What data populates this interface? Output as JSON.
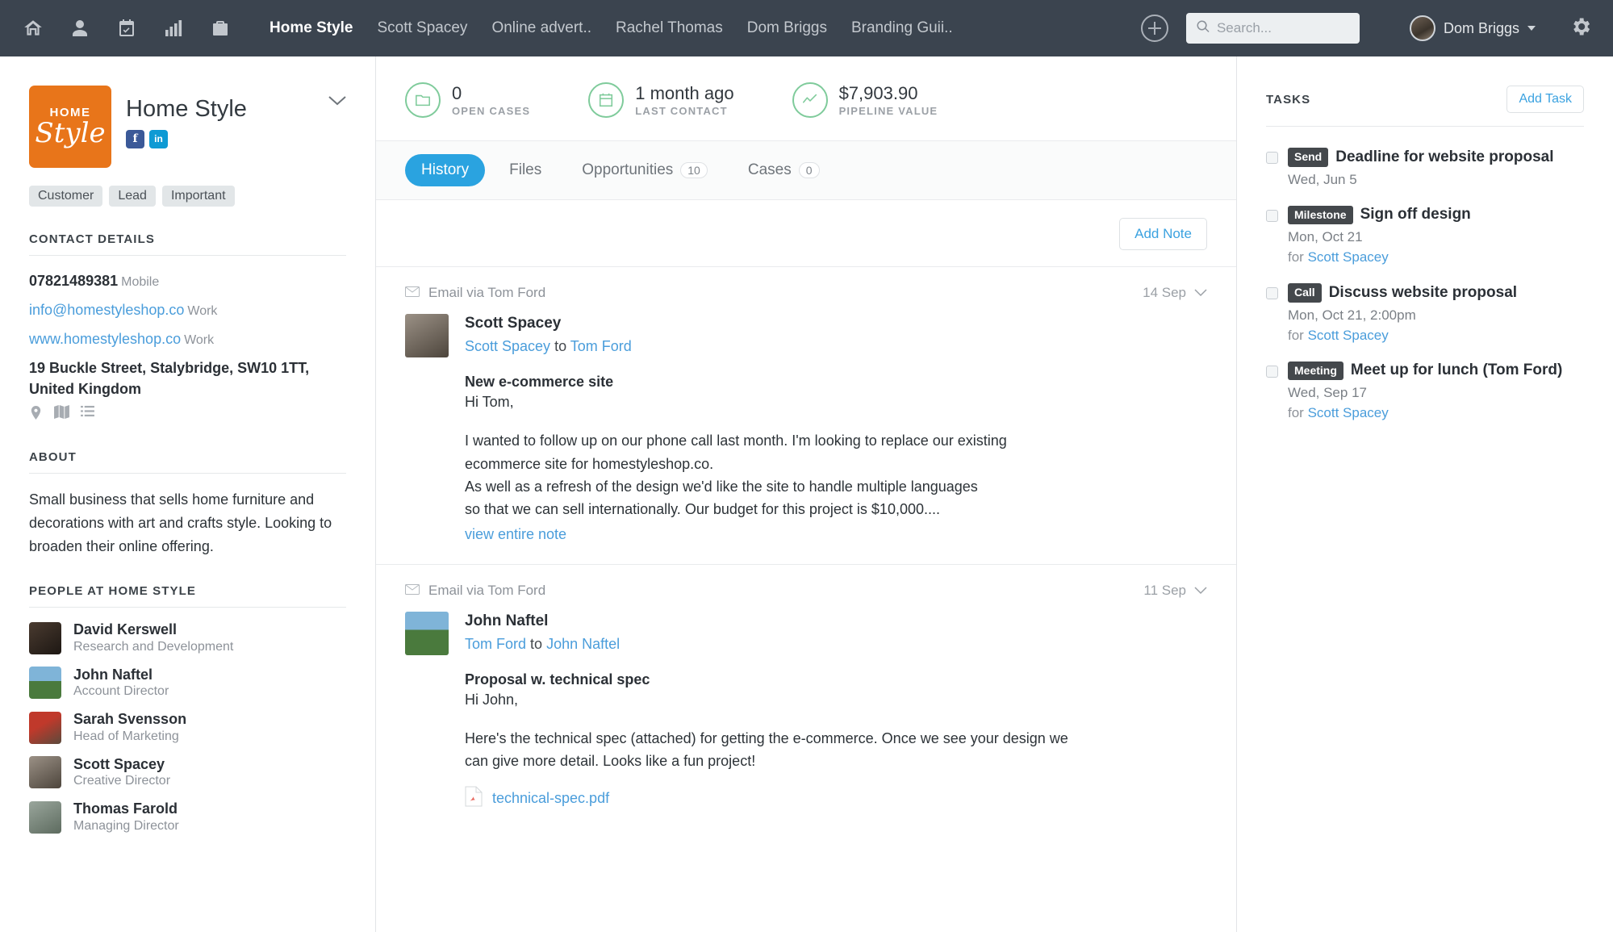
{
  "topnav": {
    "icons": [
      "home-icon",
      "person-icon",
      "calendar-icon",
      "chart-icon",
      "briefcase-icon"
    ],
    "tabs": [
      {
        "label": "Home Style",
        "active": true
      },
      {
        "label": "Scott Spacey",
        "active": false
      },
      {
        "label": "Online advert..",
        "active": false
      },
      {
        "label": "Rachel Thomas",
        "active": false
      },
      {
        "label": "Dom Briggs",
        "active": false
      },
      {
        "label": "Branding Guii..",
        "active": false
      }
    ],
    "search_placeholder": "Search...",
    "user_name": "Dom Briggs"
  },
  "company": {
    "logo_top": "HOME",
    "logo_bottom": "Style",
    "name": "Home Style",
    "socials": [
      {
        "name": "facebook-icon",
        "glyph": "f"
      },
      {
        "name": "linkedin-icon",
        "glyph": "in"
      }
    ],
    "tags": [
      "Customer",
      "Lead",
      "Important"
    ],
    "contact_details_heading": "CONTACT DETAILS",
    "contacts": [
      {
        "value": "07821489381",
        "label": "Mobile",
        "is_link": false
      },
      {
        "value": "info@homestyleshop.co",
        "label": "Work",
        "is_link": true
      },
      {
        "value": "www.homestyleshop.co",
        "label": "Work",
        "is_link": true
      }
    ],
    "address": "19 Buckle Street, Stalybridge, SW10 1TT, United Kingdom",
    "about_heading": "ABOUT",
    "about_text": "Small business that sells home furniture and decorations with art and crafts style. Looking to broaden their online offering.",
    "people_heading": "PEOPLE AT HOME STYLE",
    "people": [
      {
        "name": "David Kerswell",
        "role": "Research and Development",
        "color1": "#4a3b30",
        "color2": "#1d1713"
      },
      {
        "name": "John Naftel",
        "role": "Account Director",
        "color1": "#7fb4d8",
        "color2": "#4a7a3d"
      },
      {
        "name": "Sarah Svensson",
        "role": "Head of Marketing",
        "color1": "#c0392b",
        "color2": "#5b4a3c"
      },
      {
        "name": "Scott Spacey",
        "role": "Creative Director",
        "color1": "#9b9186",
        "color2": "#4d453c"
      },
      {
        "name": "Thomas Farold",
        "role": "Managing Director",
        "color1": "#9aa69c",
        "color2": "#5d6b5f"
      }
    ]
  },
  "stats": [
    {
      "value": "0",
      "label": "OPEN CASES",
      "icon": "folder-icon"
    },
    {
      "value": "1 month ago",
      "label": "LAST CONTACT",
      "icon": "calendar-icon"
    },
    {
      "value": "$7,903.90",
      "label": "PIPELINE VALUE",
      "icon": "trend-icon"
    }
  ],
  "tabs": [
    {
      "label": "History",
      "count": null,
      "active": true
    },
    {
      "label": "Files",
      "count": null,
      "active": false
    },
    {
      "label": "Opportunities",
      "count": "10",
      "active": false
    },
    {
      "label": "Cases",
      "count": "0",
      "active": false
    }
  ],
  "add_note_label": "Add Note",
  "feed": [
    {
      "source": "Email via Tom Ford",
      "date": "14 Sep",
      "sender": "Scott Spacey",
      "route_from": "Scott Spacey",
      "route_joiner": "to",
      "route_to": "Tom Ford",
      "subject": "New e-commerce site",
      "greeting": "Hi Tom,",
      "lines": [
        "I wanted to follow up on our phone call last month. I'm looking to replace our existing",
        "ecommerce site for homestyleshop.co.",
        "As well as a refresh of the design we'd like the site to handle multiple languages",
        "so that we can sell internationally. Our budget for this project is $10,000...."
      ],
      "view_more": "view entire note",
      "attachment": null,
      "avatar_c1": "#9b9186",
      "avatar_c2": "#4d453c"
    },
    {
      "source": "Email via Tom Ford",
      "date": "11 Sep",
      "sender": "John Naftel",
      "route_from": "Tom Ford",
      "route_joiner": "to",
      "route_to": "John Naftel",
      "subject": "Proposal w. technical spec",
      "greeting": "Hi John,",
      "lines": [
        "Here's the technical spec (attached) for getting the e-commerce. Once we see your design we",
        "can give more detail. Looks like a fun project!"
      ],
      "view_more": null,
      "attachment": "technical-spec.pdf",
      "avatar_c1": "#7fb4d8",
      "avatar_c2": "#4a7a3d"
    }
  ],
  "tasks_panel": {
    "title": "TASKS",
    "add_label": "Add Task",
    "tasks": [
      {
        "badge": "Send",
        "title": "Deadline for website proposal",
        "date": "Wed, Jun 5",
        "for_label": null,
        "for_person": null
      },
      {
        "badge": "Milestone",
        "title": "Sign off design",
        "date": "Mon, Oct 21",
        "for_label": "for",
        "for_person": "Scott Spacey"
      },
      {
        "badge": "Call",
        "title": "Discuss website proposal",
        "date": "Mon, Oct 21, 2:00pm",
        "for_label": "for",
        "for_person": "Scott Spacey"
      },
      {
        "badge": "Meeting",
        "title": "Meet up for lunch (Tom Ford)",
        "date": "Wed, Sep 17",
        "for_label": "for",
        "for_person": "Scott Spacey"
      }
    ]
  },
  "colors": {
    "nav_bg": "#3b444f",
    "accent_blue": "#2aa3e0",
    "link_blue": "#4a9ddb",
    "stat_green": "#7fcb9b",
    "logo_orange": "#e8751a"
  }
}
